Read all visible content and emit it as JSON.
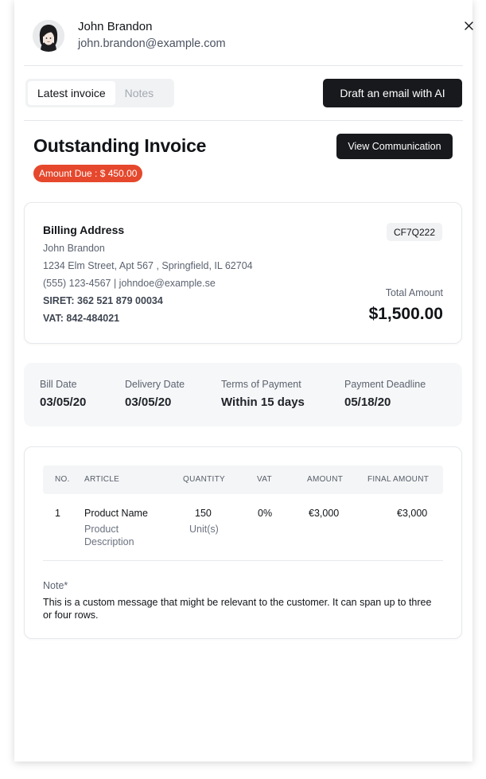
{
  "user": {
    "name": "John Brandon",
    "email": "john.brandon@example.com"
  },
  "tabs": [
    {
      "label": "Latest invoice",
      "active": true
    },
    {
      "label": "Notes",
      "active": false
    }
  ],
  "actions": {
    "draft_email": "Draft an email with AI",
    "view_communication": "View Communication"
  },
  "invoice": {
    "title": "Outstanding Invoice",
    "amount_due": "Amount Due : $ 450.00",
    "code": "CF7Q222",
    "total_label": "Total Amount",
    "total_value": "$1,500.00"
  },
  "billing": {
    "title": "Billing Address",
    "name": "John Brandon",
    "address": "1234 Elm Street, Apt 567 , Springfield, IL 62704",
    "contact": "(555) 123-4567 | johndoe@example.se",
    "siret": "SIRET: 362 521 879 00034",
    "vat": "VAT: 842-484021"
  },
  "dates": [
    {
      "label": "Bill Date",
      "value": "03/05/20"
    },
    {
      "label": "Delivery Date",
      "value": "03/05/20"
    },
    {
      "label": "Terms of Payment",
      "value": "Within 15 days"
    },
    {
      "label": "Payment Deadline",
      "value": "05/18/20"
    }
  ],
  "table": {
    "headers": [
      "NO.",
      "ARTICLE",
      "QUANTITY",
      "VAT",
      "AMOUNT",
      "FINAL AMOUNT"
    ],
    "rows": [
      {
        "no": "1",
        "article": "Product Name",
        "description_1": "Product",
        "description_2": "Description",
        "quantity": "150",
        "unit": "Unit(s)",
        "vat": "0%",
        "amount": "€3,000",
        "final_amount": "€3,000"
      }
    ]
  },
  "note": {
    "label": "Note*",
    "text": "This is a custom message that might be relevant to the customer. It can span up to three or four rows."
  },
  "colors": {
    "accent_red": "#e5482d",
    "button_dark": "#17191c"
  }
}
